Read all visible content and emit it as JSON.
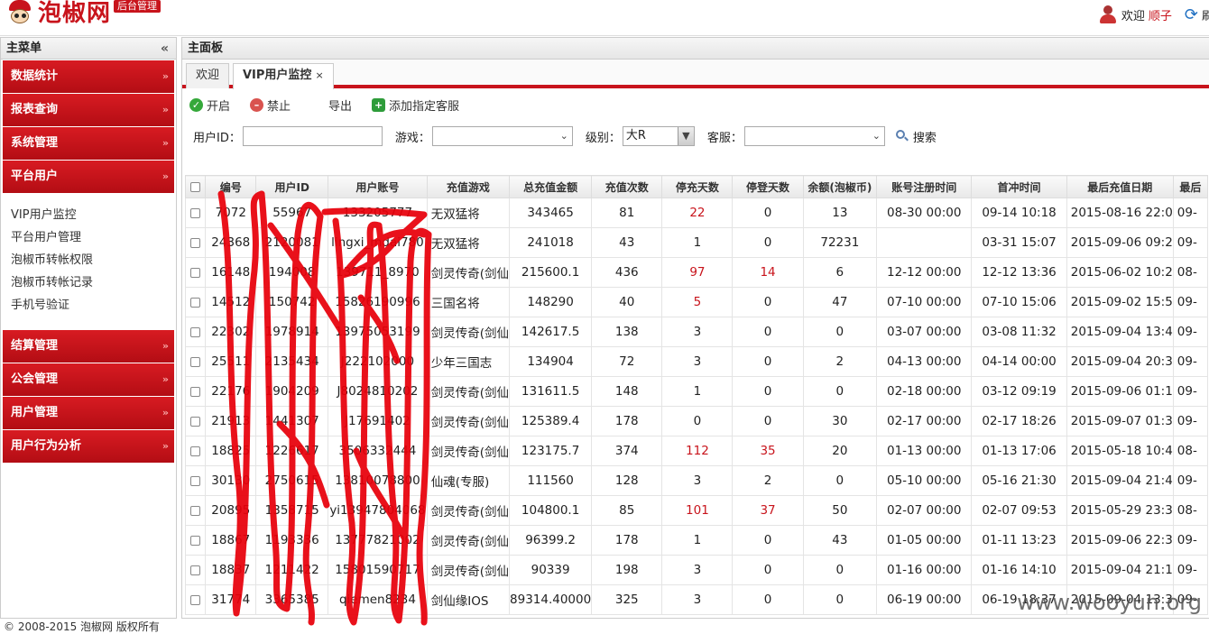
{
  "header": {
    "brand": "泡椒网",
    "badge": "后台管理",
    "welcome": "欢迎",
    "username": "顺子",
    "refresh_label": "刷"
  },
  "sidebar": {
    "title": "主菜单",
    "collapse": "«",
    "groups_top": [
      {
        "label": "数据统计"
      },
      {
        "label": "报表查询"
      },
      {
        "label": "系统管理"
      },
      {
        "label": "平台用户"
      }
    ],
    "submenu": [
      {
        "label": "VIP用户监控"
      },
      {
        "label": "平台用户管理"
      },
      {
        "label": "泡椒币转帐权限"
      },
      {
        "label": "泡椒币转帐记录"
      },
      {
        "label": "手机号验证"
      }
    ],
    "groups_bottom": [
      {
        "label": "结算管理"
      },
      {
        "label": "公会管理"
      },
      {
        "label": "用户管理"
      },
      {
        "label": "用户行为分析"
      }
    ]
  },
  "main": {
    "title": "主面板",
    "tabs": [
      {
        "label": "欢迎"
      },
      {
        "label": "VIP用户监控",
        "close": "×"
      }
    ],
    "toolbar": {
      "enable": "开启",
      "disable": "禁止",
      "export": "导出",
      "add_service": "添加指定客服"
    },
    "search": {
      "user_id_label": "用户ID：",
      "user_id_value": "",
      "game_label": "游戏：",
      "game_value": "",
      "level_label": "级别：",
      "level_value": "大R",
      "service_label": "客服：",
      "service_value": "",
      "search_button": "搜索"
    },
    "columns": [
      "编号",
      "用户ID",
      "用户账号",
      "充值游戏",
      "总充值金额",
      "充值次数",
      "停充天数",
      "停登天数",
      "余额(泡椒币)",
      "账号注册时间",
      "首冲时间",
      "最后充值日期",
      "最后"
    ],
    "rows": [
      [
        "7072",
        "55967",
        "133205777",
        "无双猛将",
        "343465",
        "81",
        "22",
        "0",
        "13",
        "08-30 00:00",
        "09-14 10:18",
        "2015-08-16 22:0",
        "09-"
      ],
      [
        "24368",
        "2120081",
        "lingxi_mdai780",
        "无双猛将",
        "241018",
        "43",
        "1",
        "0",
        "72231",
        "",
        "03-31 15:07",
        "2015-09-06 09:2",
        "09-"
      ],
      [
        "16148",
        "194008",
        "139711_8970",
        "剑灵传奇(剑仙",
        "215600.1",
        "436",
        "97",
        "14",
        "6",
        "12-12 00:00",
        "12-12 13:36",
        "2015-06-02 10:2",
        "08-"
      ],
      [
        "14512",
        "150742",
        "15826190996",
        "三国名将",
        "148290",
        "40",
        "5",
        "0",
        "47",
        "07-10 00:00",
        "07-10 15:06",
        "2015-09-02 15:5",
        "09-"
      ],
      [
        "22302",
        "1978914",
        "13975053199",
        "剑灵传奇(剑仙",
        "142617.5",
        "138",
        "3",
        "0",
        "0",
        "03-07 00:00",
        "03-08 11:32",
        "2015-09-04 13:4",
        "09-"
      ],
      [
        "25511",
        "2135434",
        "J222102000",
        "少年三国志",
        "134904",
        "72",
        "3",
        "0",
        "2",
        "04-13 00:00",
        "04-14 00:00",
        "2015-09-04 20:3",
        "09-"
      ],
      [
        "22176",
        "1904209",
        "J8024810202",
        "剑灵传奇(剑仙",
        "131611.5",
        "148",
        "1",
        "0",
        "0",
        "02-18 00:00",
        "03-12 09:19",
        "2015-09-06 01:1",
        "09-"
      ],
      [
        "21913",
        "1441307",
        "J17691402",
        "剑灵传奇(剑仙",
        "125389.4",
        "178",
        "0",
        "0",
        "30",
        "02-17 00:00",
        "02-17 18:26",
        "2015-09-07 01:3",
        "09-"
      ],
      [
        "18825",
        "1226617",
        "3506332444",
        "剑灵传奇(剑仙",
        "123175.7",
        "374",
        "112",
        "35",
        "20",
        "01-13 00:00",
        "01-13 17:06",
        "2015-05-18 10:4",
        "08-"
      ],
      [
        "30130",
        "2750615",
        "13810078800",
        "仙魂(专服)",
        "111560",
        "128",
        "3",
        "2",
        "0",
        "05-10 00:00",
        "05-16 21:30",
        "2015-09-04 21:4",
        "09-"
      ],
      [
        "20895",
        "1358715",
        "yi13947804068",
        "剑灵传奇(剑仙",
        "104800.1",
        "85",
        "101",
        "37",
        "50",
        "02-07 00:00",
        "02-07 09:53",
        "2015-05-29 23:3",
        "08-"
      ],
      [
        "18867",
        "1193336",
        "13777821002",
        "剑灵传奇(剑仙",
        "96399.2",
        "178",
        "1",
        "0",
        "43",
        "01-05 00:00",
        "01-11 13:23",
        "2015-09-06 22:3",
        "09-"
      ],
      [
        "18837",
        "1211422",
        "15801590717",
        "剑灵传奇(剑仙",
        "90339",
        "198",
        "3",
        "0",
        "0",
        "01-16 00:00",
        "01-16 14:10",
        "2015-09-04 21:1",
        "09-"
      ],
      [
        "31774",
        "3365385",
        "qiemen8234",
        "剑仙缘IOS",
        "89314.40000",
        "325",
        "3",
        "0",
        "0",
        "06-19 00:00",
        "06-19 18:37",
        "2015-09-04 13:3",
        "09-"
      ]
    ]
  },
  "footer": "© 2008-2015 泡椒网 版权所有",
  "watermark": "www.wooyun.org",
  "colors": {
    "accent": "#c8141c",
    "highlight_text": "#c8141c"
  }
}
